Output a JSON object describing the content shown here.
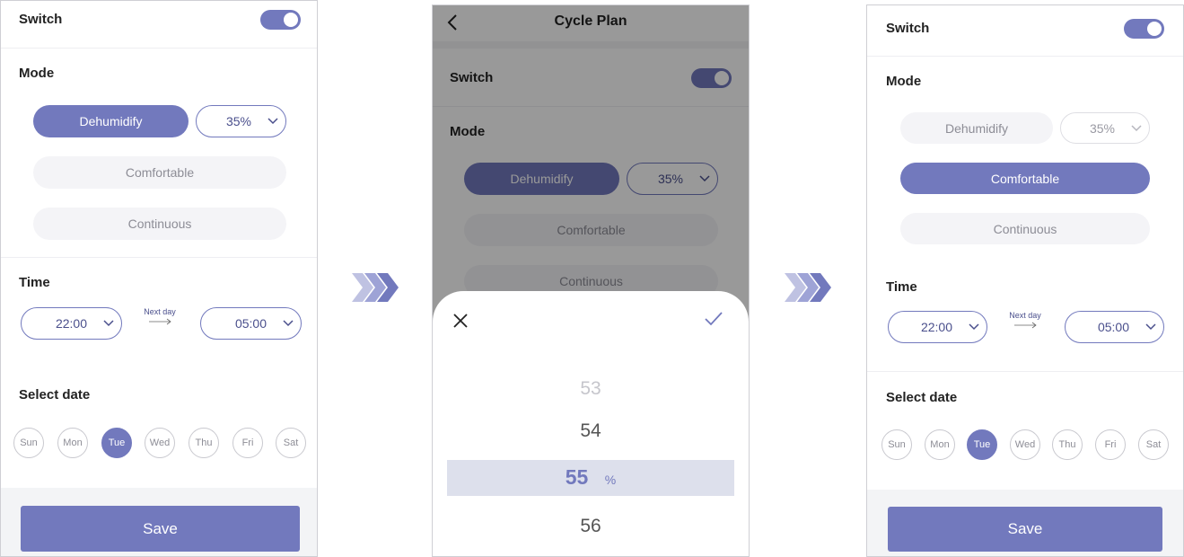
{
  "screens": [
    {
      "switch_label": "Switch",
      "switch_on": true,
      "mode_label": "Mode",
      "modes": {
        "dehumidify": "Dehumidify",
        "comfortable": "Comfortable",
        "continuous": "Continuous"
      },
      "selected_mode": "Dehumidify",
      "humidity_value": "35%",
      "time_label": "Time",
      "start_time": "22:00",
      "next_day": "Next day",
      "end_time": "05:00",
      "select_date_label": "Select date",
      "days": [
        "Sun",
        "Mon",
        "Tue",
        "Wed",
        "Thu",
        "Fri",
        "Sat"
      ],
      "selected_day": "Tue",
      "save_label": "Save"
    },
    {
      "title": "Cycle Plan",
      "switch_label": "Switch",
      "switch_on": true,
      "mode_label": "Mode",
      "modes": {
        "dehumidify": "Dehumidify",
        "comfortable": "Comfortable",
        "continuous": "Continuous"
      },
      "selected_mode": "Dehumidify",
      "humidity_value": "35%",
      "picker": {
        "items": [
          "53",
          "54",
          "55",
          "56"
        ],
        "selected": "55",
        "unit": "%"
      }
    },
    {
      "switch_label": "Switch",
      "switch_on": true,
      "mode_label": "Mode",
      "modes": {
        "dehumidify": "Dehumidify",
        "comfortable": "Comfortable",
        "continuous": "Continuous"
      },
      "selected_mode": "Comfortable",
      "humidity_value": "35%",
      "time_label": "Time",
      "start_time": "22:00",
      "next_day": "Next day",
      "end_time": "05:00",
      "select_date_label": "Select date",
      "days": [
        "Sun",
        "Mon",
        "Tue",
        "Wed",
        "Thu",
        "Fri",
        "Sat"
      ],
      "selected_day": "Tue",
      "save_label": "Save"
    }
  ],
  "colors": {
    "accent": "#7279bd",
    "accent_dark": "#4a4f8c",
    "light_pill": "#f4f4f7",
    "footer": "#f3f4f6"
  }
}
